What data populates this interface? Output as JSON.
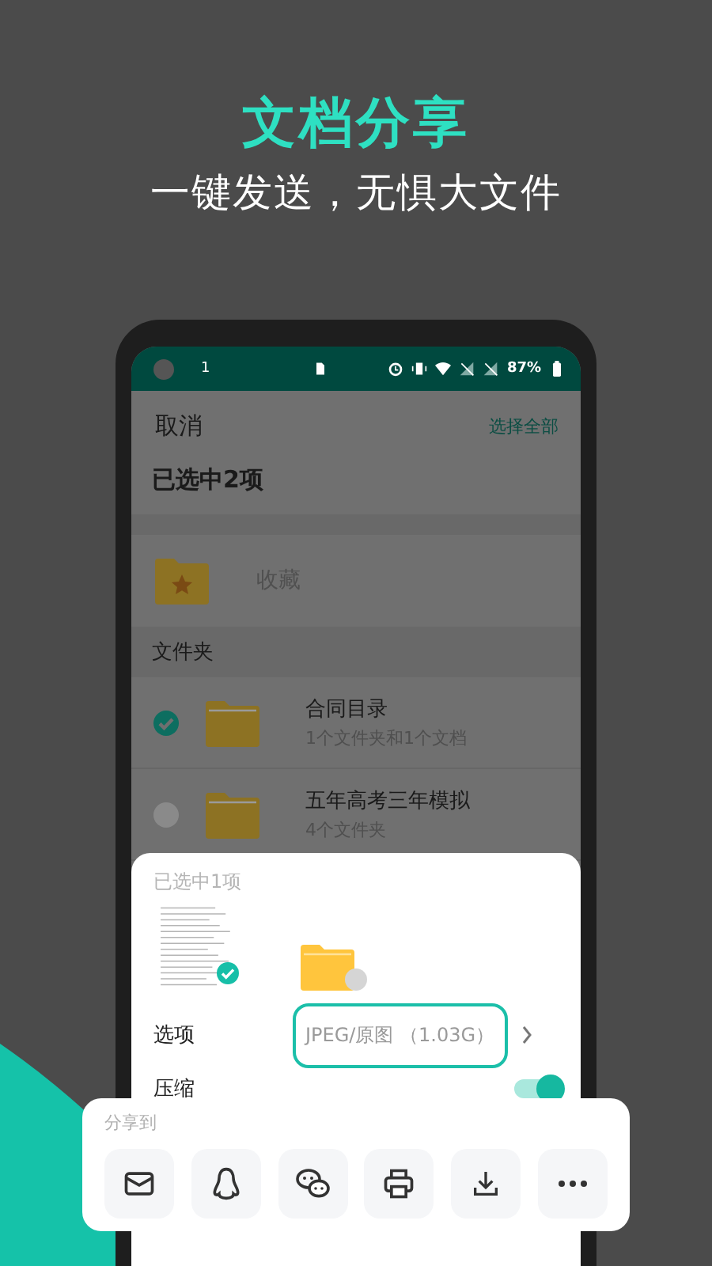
{
  "banner": {
    "title": "文档分享",
    "subtitle": "一键发送，无惧大文件"
  },
  "status_bar": {
    "notification": "1",
    "battery": "87%"
  },
  "header": {
    "cancel": "取消",
    "select_all": "选择全部"
  },
  "selection_title": "已选中2项",
  "favorites": {
    "label": "收藏"
  },
  "section_title": "文件夹",
  "folders": [
    {
      "name": "合同目录",
      "detail": "1个文件夹和1个文档",
      "selected": true
    },
    {
      "name": "五年高考三年模拟",
      "detail": "4个文件夹",
      "selected": false
    }
  ],
  "sheet": {
    "title": "已选中1项",
    "items": [
      {
        "kind": "document",
        "selected": true
      },
      {
        "kind": "folder",
        "selected": false
      }
    ],
    "options_label": "选项",
    "options_value": "JPEG/原图 （1.03G）",
    "compress_label": "压缩",
    "compress_on": true
  },
  "share": {
    "title": "分享到",
    "targets": [
      {
        "kind": "mail"
      },
      {
        "kind": "penguin"
      },
      {
        "kind": "chat"
      },
      {
        "kind": "print"
      },
      {
        "kind": "download"
      },
      {
        "kind": "more"
      }
    ]
  }
}
